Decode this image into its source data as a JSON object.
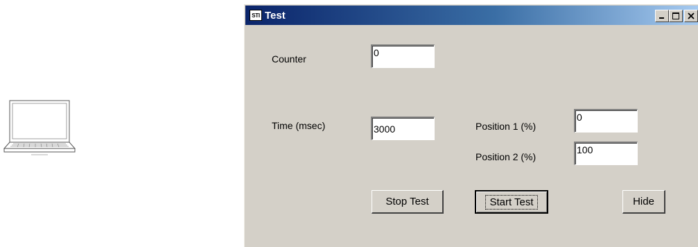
{
  "window": {
    "title": "Test",
    "icon_text": "STI"
  },
  "form": {
    "counter_label": "Counter",
    "counter_value": "0",
    "time_label": "Time (msec)",
    "time_value": "3000",
    "position1_label": "Position 1 (%)",
    "position1_value": "0",
    "position2_label": "Position 2 (%)",
    "position2_value": "100"
  },
  "buttons": {
    "stop": "Stop Test",
    "start": "Start Test",
    "hide": "Hide"
  },
  "colors": {
    "titlebar_start": "#0a246a",
    "titlebar_end": "#a6caf0",
    "face": "#d4d0c8"
  }
}
